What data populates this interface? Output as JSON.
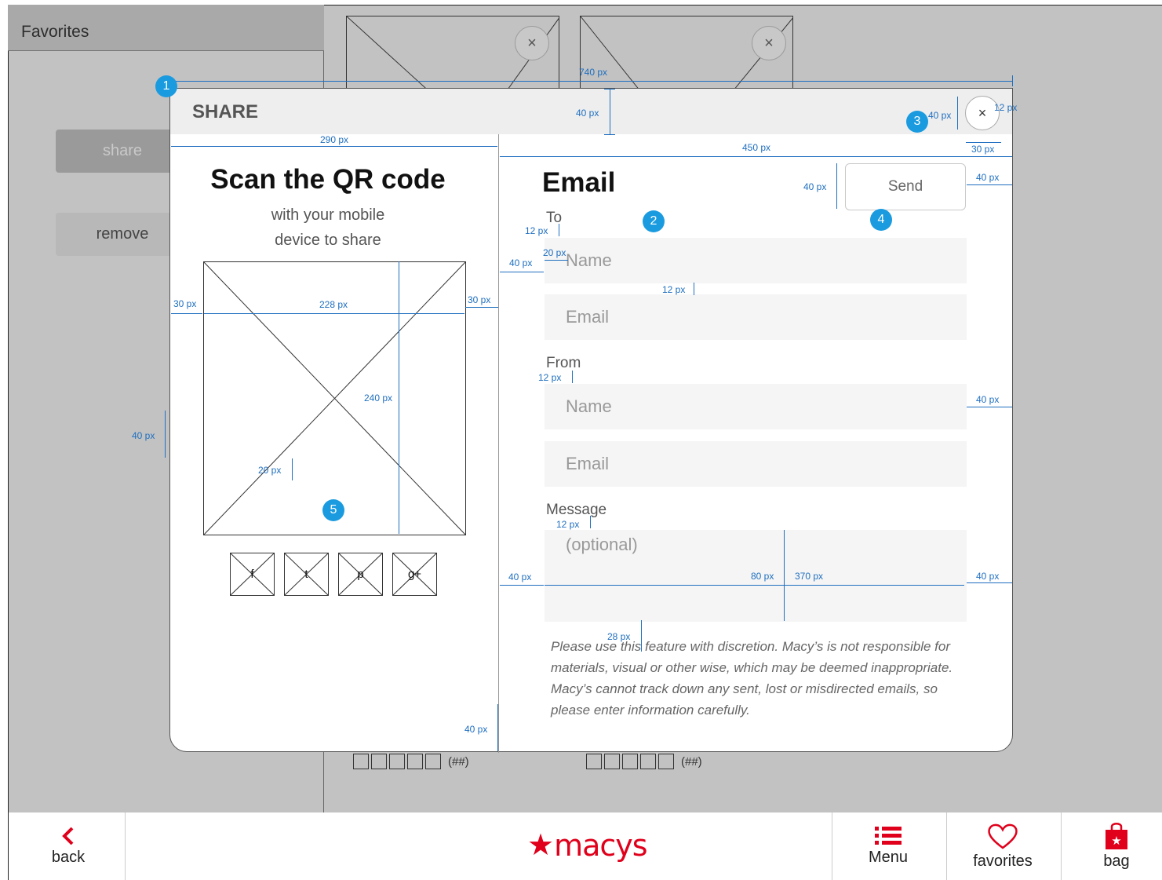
{
  "colors": {
    "accent": "#e0001b",
    "annotation": "#1f6fc0",
    "marker": "#1a9be0"
  },
  "background": {
    "favorites_title": "Favorites",
    "share_button": "share",
    "remove_button": "remove",
    "thumb_close": "×",
    "rating_count_1": "(##)",
    "rating_count_2": "(##)"
  },
  "modal": {
    "title": "SHARE",
    "close": "×",
    "qr": {
      "title": "Scan the QR code",
      "subtitle_line1": "with your mobile",
      "subtitle_line2": "device to share",
      "social": [
        "f",
        "t",
        "p",
        "g+"
      ]
    },
    "email": {
      "title": "Email",
      "send_label": "Send",
      "to_label": "To",
      "to_name_placeholder": "Name",
      "to_email_placeholder": "Email",
      "from_label": "From",
      "from_name_placeholder": "Name",
      "from_email_placeholder": "Email",
      "message_label": "Message",
      "message_placeholder": "(optional)",
      "disclaimer": "Please use this feature with discretion. Macy’s is not responsible for  materials, visual or other wise, which may be deemed inappropriate. Macy’s cannot track down any sent, lost or misdirected emails, so please enter information carefully."
    }
  },
  "annotations": {
    "markers": [
      "1",
      "2",
      "3",
      "4",
      "5"
    ],
    "labels": {
      "w740": "740 px",
      "h40_header": "40 px",
      "close_40": "40 px",
      "close_12": "12 px",
      "close_30": "30 px",
      "w290": "290 px",
      "w450": "450 px",
      "send_40h": "40 px",
      "send_40r": "40 px",
      "to_12": "12 px",
      "field_20": "20 px",
      "left_40": "40 px",
      "gap_12": "12 px",
      "qr_30l": "30 px",
      "qr_228": "228 px",
      "qr_30r": "30 px",
      "qr_240": "240 px",
      "side_40": "40 px",
      "social_20": "20 px",
      "from_12": "12 px",
      "from_40r": "40 px",
      "msg_12": "12 px",
      "msg_40l": "40 px",
      "msg_80": "80 px",
      "msg_370": "370 px",
      "msg_40r": "40 px",
      "disc_28": "28 px",
      "bottom_40": "40 px"
    }
  },
  "nav": {
    "back_label": "back",
    "logo_text": "macys",
    "menu_label": "Menu",
    "favorites_label": "favorites",
    "bag_label": "bag"
  }
}
